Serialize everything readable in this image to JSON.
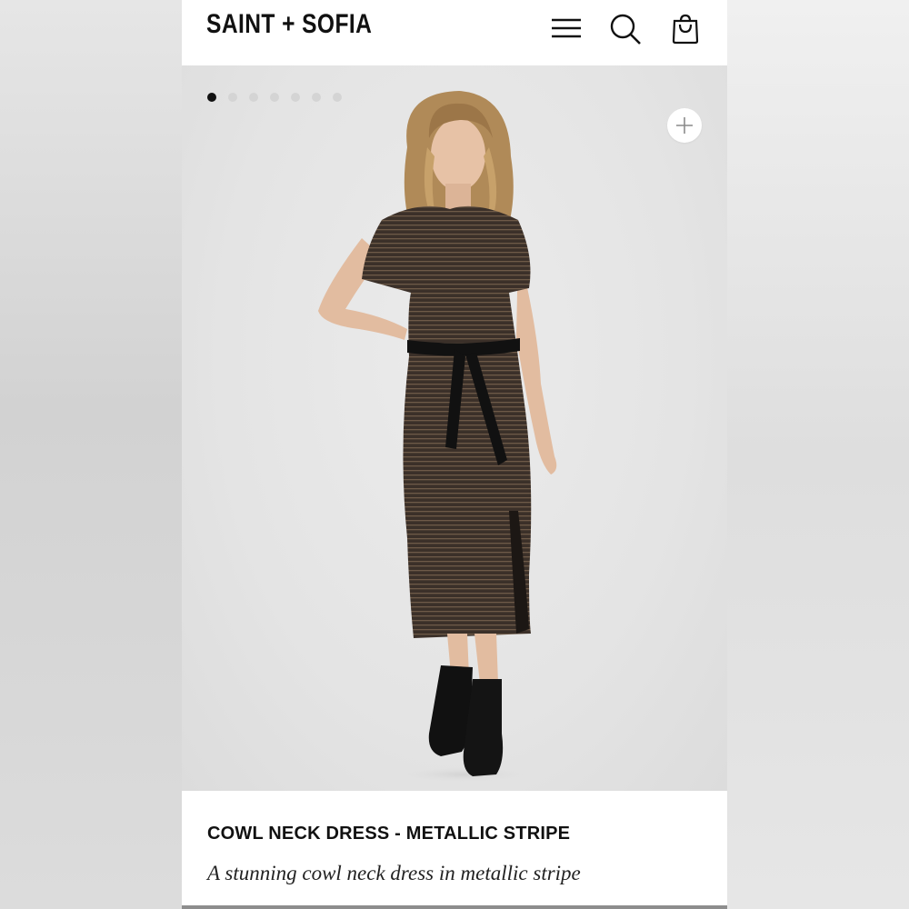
{
  "brand": {
    "logo_text": "SAINT + SOFIA"
  },
  "header": {
    "menu_icon": "menu-icon",
    "search_icon": "search-icon",
    "bag_icon": "shopping-bag-icon"
  },
  "gallery": {
    "image_count": 7,
    "active_index": 0,
    "zoom_icon": "plus-icon",
    "image_alt": "Model wearing cowl neck dress in metallic stripe with black belt and boots"
  },
  "product": {
    "title": "COWL NECK DRESS - METALLIC STRIPE",
    "subtitle": "A stunning cowl neck dress in metallic stripe"
  },
  "colors": {
    "header_bg": "#ffffff",
    "gallery_bg": "#e6e6e6",
    "active_dot": "#111111",
    "inactive_dot": "#d4d4d4",
    "text": "#111111"
  }
}
